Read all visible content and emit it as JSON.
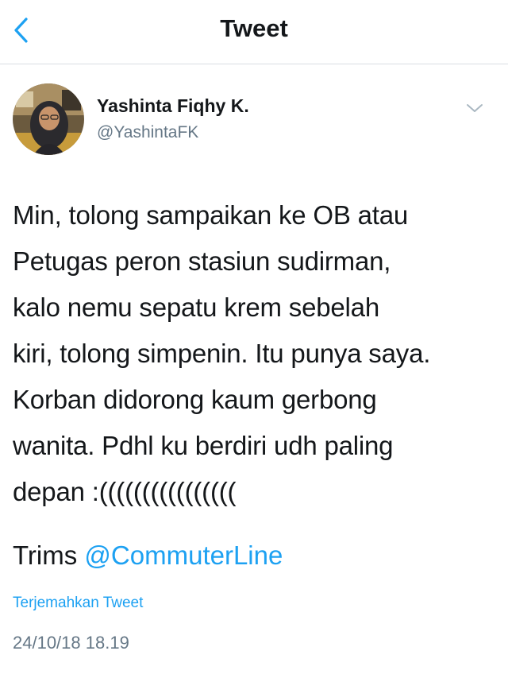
{
  "header": {
    "title": "Tweet",
    "back_icon": "chevron-left-icon"
  },
  "author": {
    "name": "Yashinta Fiqhy K.",
    "handle": "@YashintaFK",
    "menu_icon": "chevron-down-icon"
  },
  "tweet": {
    "lines": [
      "Min, tolong sampaikan ke OB atau",
      "Petugas peron stasiun sudirman,",
      "kalo nemu sepatu krem sebelah",
      "kiri, tolong simpenin. Itu punya saya.",
      "Korban didorong kaum gerbong",
      "wanita. Pdhl ku berdiri udh paling",
      "depan :(((((((((((((((("
    ],
    "trims_prefix": "Trims ",
    "mention": "@CommuterLine",
    "translate_label": "Terjemahkan Tweet",
    "timestamp": "24/10/18 18.19"
  },
  "colors": {
    "accent": "#1da1f2",
    "text": "#14171a",
    "secondary": "#657786"
  }
}
